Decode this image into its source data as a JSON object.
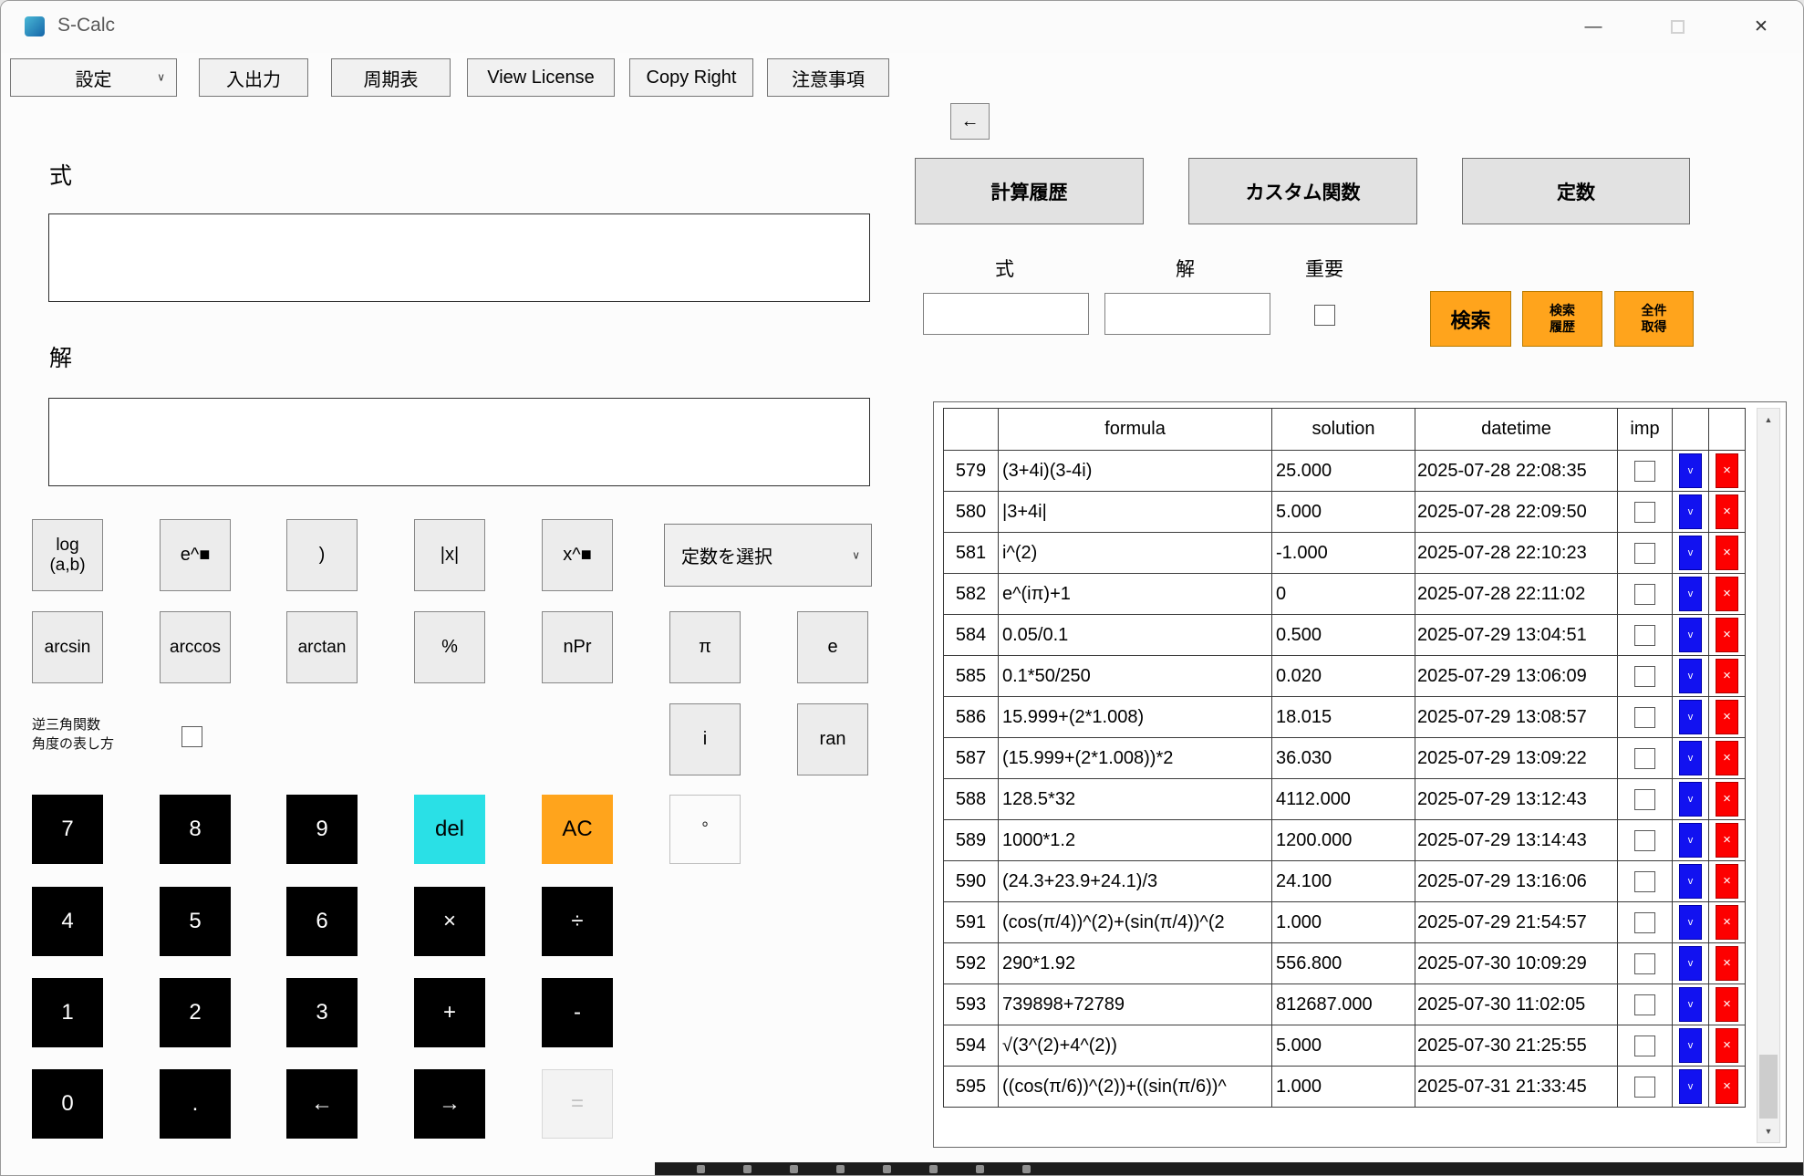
{
  "window": {
    "title": "S-Calc",
    "minimize_glyph": "—",
    "close_glyph": "✕"
  },
  "icons": {
    "chevron_down": "∨",
    "scroll_up": "▲",
    "scroll_down": "▼"
  },
  "toolbar": {
    "settings_dropdown": "設定",
    "io_button": "入出力",
    "periodic_table_button": "周期表",
    "view_license_button": "View License",
    "copyright_button": "Copy Right",
    "notes_button": "注意事項"
  },
  "calc": {
    "formula_label": "式",
    "formula_value": "",
    "solution_label": "解",
    "solution_value": "",
    "inverse_trig_label": "逆三角関数\n角度の表し方",
    "constant_dropdown": "定数を選択",
    "keys": {
      "log": "log\n(a,b)",
      "epow": "e^■",
      "rparen": ")",
      "abs": "|x|",
      "xpow": "x^■",
      "arcsin": "arcsin",
      "arccos": "arccos",
      "arctan": "arctan",
      "percent": "%",
      "npr": "nPr",
      "pi": "π",
      "e": "e",
      "i": "i",
      "ran": "ran",
      "degree": "°",
      "d7": "7",
      "d8": "8",
      "d9": "9",
      "del": "del",
      "ac": "AC",
      "d4": "4",
      "d5": "5",
      "d6": "6",
      "mul": "×",
      "div": "÷",
      "d1": "1",
      "d2": "2",
      "d3": "3",
      "add": "+",
      "sub": "-",
      "d0": "0",
      "dot": ".",
      "left": "←",
      "right": "→",
      "eq": "="
    }
  },
  "right": {
    "back_button": "←",
    "tabs": [
      "計算履歴",
      "カスタム関数",
      "定数"
    ],
    "search": {
      "formula_label": "式",
      "solution_label": "解",
      "important_label": "重要",
      "formula_value": "",
      "solution_value": "",
      "search_button": "検索",
      "search_history_button": "検索\n履歴",
      "get_all_button": "全件\n取得"
    },
    "table": {
      "headers": {
        "formula": "formula",
        "solution": "solution",
        "datetime": "datetime",
        "imp": "imp"
      },
      "blue_button_glyph": "v",
      "red_button_glyph": "×",
      "rows": [
        {
          "id": "579",
          "formula": "(3+4i)(3-4i)",
          "solution": "25.000",
          "datetime": "2025-07-28 22:08:35"
        },
        {
          "id": "580",
          "formula": "|3+4i|",
          "solution": "5.000",
          "datetime": "2025-07-28 22:09:50"
        },
        {
          "id": "581",
          "formula": "i^(2)",
          "solution": "-1.000",
          "datetime": "2025-07-28 22:10:23"
        },
        {
          "id": "582",
          "formula": "e^(iπ)+1",
          "solution": "0",
          "datetime": "2025-07-28 22:11:02"
        },
        {
          "id": "584",
          "formula": "0.05/0.1",
          "solution": "0.500",
          "datetime": "2025-07-29 13:04:51"
        },
        {
          "id": "585",
          "formula": "0.1*50/250",
          "solution": "0.020",
          "datetime": "2025-07-29 13:06:09"
        },
        {
          "id": "586",
          "formula": "15.999+(2*1.008)",
          "solution": "18.015",
          "datetime": "2025-07-29 13:08:57"
        },
        {
          "id": "587",
          "formula": "(15.999+(2*1.008))*2",
          "solution": "36.030",
          "datetime": "2025-07-29 13:09:22"
        },
        {
          "id": "588",
          "formula": "128.5*32",
          "solution": "4112.000",
          "datetime": "2025-07-29 13:12:43"
        },
        {
          "id": "589",
          "formula": "1000*1.2",
          "solution": "1200.000",
          "datetime": "2025-07-29 13:14:43"
        },
        {
          "id": "590",
          "formula": "(24.3+23.9+24.1)/3",
          "solution": "24.100",
          "datetime": "2025-07-29 13:16:06"
        },
        {
          "id": "591",
          "formula": "(cos(π/4))^(2)+(sin(π/4))^(2",
          "solution": "1.000",
          "datetime": "2025-07-29 21:54:57"
        },
        {
          "id": "592",
          "formula": "290*1.92",
          "solution": "556.800",
          "datetime": "2025-07-30 10:09:29"
        },
        {
          "id": "593",
          "formula": "739898+72789",
          "solution": "812687.000",
          "datetime": "2025-07-30 11:02:05"
        },
        {
          "id": "594",
          "formula": "√(3^(2)+4^(2))",
          "solution": "5.000",
          "datetime": "2025-07-30 21:25:55"
        },
        {
          "id": "595",
          "formula": "((cos(π/6))^(2))+((sin(π/6))^",
          "solution": "1.000",
          "datetime": "2025-07-31 21:33:45"
        }
      ]
    }
  },
  "colors": {
    "accent_orange": "#ffa41c",
    "delete_key_cyan": "#2ae0e6",
    "keypad_black": "#000000",
    "row_edit_blue": "#1212f0",
    "row_delete_red": "#fd0000"
  }
}
